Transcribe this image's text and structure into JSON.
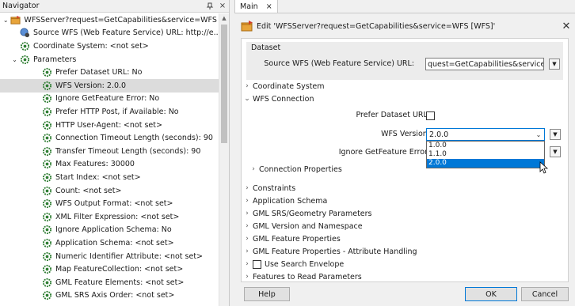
{
  "navigator": {
    "title": "Navigator",
    "pin_label": "⨯",
    "items": [
      {
        "label": "WFSServer?request=GetCapabilities&service=WFS [...",
        "icon": "wfs-reader-icon"
      },
      {
        "label": "Source WFS (Web Feature Service) URL: http://e...",
        "icon": "globe-gear-icon"
      },
      {
        "label": "Coordinate System: <not set>",
        "icon": "gear-icon"
      },
      {
        "label": "Parameters",
        "icon": "gear-icon"
      },
      {
        "label": "Prefer Dataset URL: No",
        "icon": "gear-icon"
      },
      {
        "label": "WFS Version: 2.0.0",
        "icon": "gear-icon"
      },
      {
        "label": "Ignore GetFeature Error: No",
        "icon": "gear-icon"
      },
      {
        "label": "Prefer HTTP Post, if Available: No",
        "icon": "gear-icon"
      },
      {
        "label": "HTTP User-Agent: <not set>",
        "icon": "gear-icon"
      },
      {
        "label": "Connection Timeout Length (seconds): 90",
        "icon": "gear-icon"
      },
      {
        "label": "Transfer Timeout Length (seconds): 90",
        "icon": "gear-icon"
      },
      {
        "label": "Max Features: 30000",
        "icon": "gear-icon"
      },
      {
        "label": "Start Index: <not set>",
        "icon": "gear-icon"
      },
      {
        "label": "Count: <not set>",
        "icon": "gear-icon"
      },
      {
        "label": "WFS Output Format: <not set>",
        "icon": "gear-icon"
      },
      {
        "label": "XML Filter Expression: <not set>",
        "icon": "gear-icon"
      },
      {
        "label": "Ignore Application Schema: No",
        "icon": "gear-icon"
      },
      {
        "label": "Application Schema: <not set>",
        "icon": "gear-icon"
      },
      {
        "label": "Numeric Identifier Attribute: <not set>",
        "icon": "gear-icon"
      },
      {
        "label": "Map FeatureCollection: <not set>",
        "icon": "gear-icon"
      },
      {
        "label": "GML Feature Elements: <not set>",
        "icon": "gear-icon"
      },
      {
        "label": "GML SRS Axis Order: <not set>",
        "icon": "gear-icon"
      }
    ]
  },
  "main": {
    "tab_label": "Main",
    "tab_close": "×",
    "dialog_title": "Edit 'WFSServer?request=GetCapabilities&service=WFS [WFS]'",
    "close_glyph": "✕",
    "dataset": {
      "heading": "Dataset",
      "url_label": "Source WFS (Web Feature Service) URL:",
      "url_value": "quest=GetCapabilities&service=WFS"
    },
    "coordinate_system": "Coordinate System",
    "wfs_connection": "WFS Connection",
    "prefer_dataset_url_label": "Prefer Dataset URL:",
    "wfs_version_label": "WFS Version:",
    "wfs_version_value": "2.0.0",
    "ignore_getfeature_label": "Ignore GetFeature Error:",
    "version_options": [
      "1.0.0",
      "1.1.0",
      "2.0.0"
    ],
    "connection_properties": "Connection Properties",
    "sections": [
      "Constraints",
      "Application Schema",
      "GML SRS/Geometry Parameters",
      "GML Version and Namespace",
      "GML Feature Properties",
      "GML Feature Properties - Attribute Handling"
    ],
    "use_search_envelope": "Use Search Envelope",
    "features_to_read": "Features to Read Parameters",
    "buttons": {
      "help": "Help",
      "ok": "OK",
      "cancel": "Cancel"
    }
  },
  "colors": {
    "accent": "#0078d7",
    "gear": "#2e7d32",
    "selection": "#dcdcdc"
  }
}
